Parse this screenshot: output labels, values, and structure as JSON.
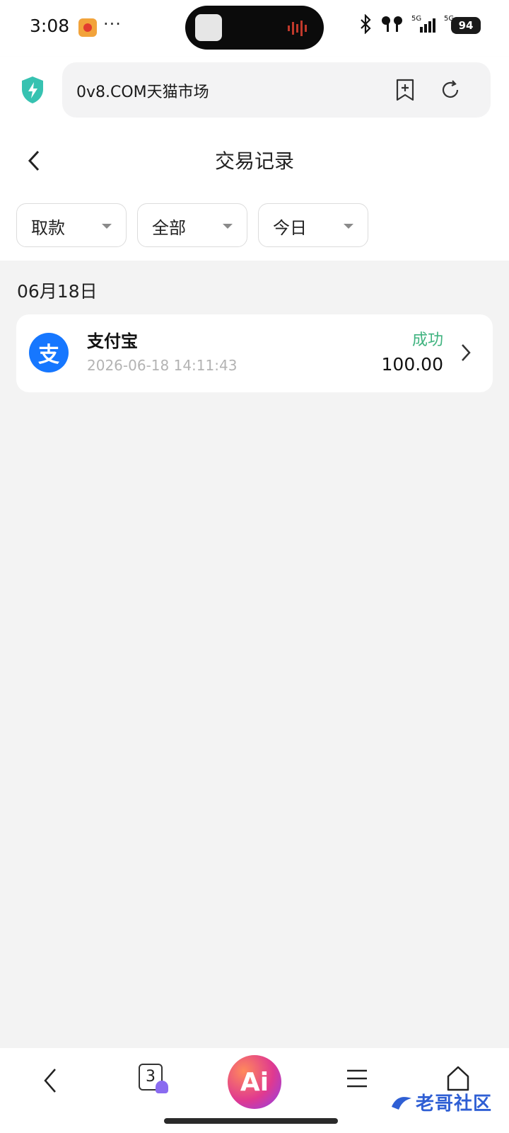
{
  "status_bar": {
    "time": "3:08",
    "battery": "94",
    "network_labels": [
      "5G",
      "5G"
    ]
  },
  "browser": {
    "url": "0v8.COM天猫市场",
    "accent": "#37c2b1"
  },
  "page": {
    "title": "交易记录"
  },
  "filters": [
    {
      "label": "取款"
    },
    {
      "label": "全部"
    },
    {
      "label": "今日"
    }
  ],
  "groups": [
    {
      "date": "06月18日",
      "transactions": [
        {
          "name": "支付宝",
          "icon_glyph": "支",
          "datetime": "2026-06-18 14:11:43",
          "status": "成功",
          "amount": "100.00",
          "status_color": "#3fb37f"
        }
      ]
    }
  ],
  "bottom_nav": {
    "tabs_count": "3",
    "ai_label": "Ai",
    "watermark": "老哥社区"
  }
}
